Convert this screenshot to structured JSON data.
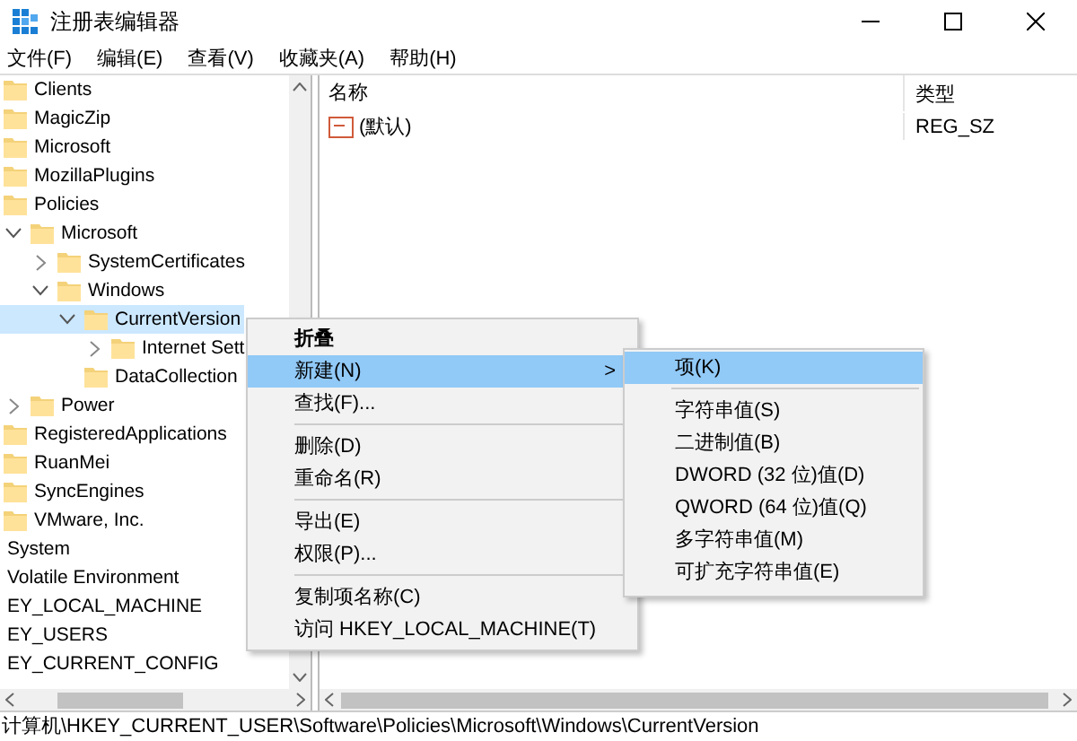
{
  "window": {
    "title": "注册表编辑器"
  },
  "menu_bar": [
    "文件(F)",
    "编辑(E)",
    "查看(V)",
    "收藏夹(A)",
    "帮助(H)"
  ],
  "tree": [
    {
      "label": "Clients",
      "kind": "leaf",
      "selected": false
    },
    {
      "label": "MagicZip",
      "kind": "leaf",
      "selected": false
    },
    {
      "label": "Microsoft",
      "kind": "leaf",
      "selected": false
    },
    {
      "label": "MozillaPlugins",
      "kind": "leaf",
      "selected": false
    },
    {
      "label": "Policies",
      "kind": "leaf",
      "selected": false,
      "children": [
        {
          "label": "Microsoft",
          "kind": "open",
          "selected": false,
          "children": [
            {
              "label": "SystemCertificates",
              "kind": "closed",
              "selected": false
            },
            {
              "label": "Windows",
              "kind": "open",
              "selected": false,
              "children": [
                {
                  "label": "CurrentVersion",
                  "kind": "open",
                  "selected": true,
                  "children": [
                    {
                      "label": "Internet Sett",
                      "kind": "closed",
                      "selected": false
                    }
                  ]
                },
                {
                  "label": "DataCollection",
                  "kind": "leaf",
                  "selected": false
                }
              ]
            }
          ]
        },
        {
          "label": "Power",
          "kind": "closed",
          "selected": false
        }
      ]
    },
    {
      "label": "RegisteredApplications",
      "kind": "leaf",
      "selected": false
    },
    {
      "label": "RuanMei",
      "kind": "leaf",
      "selected": false
    },
    {
      "label": "SyncEngines",
      "kind": "leaf",
      "selected": false
    },
    {
      "label": "VMware, Inc.",
      "kind": "leaf",
      "selected": false
    },
    {
      "label": "System",
      "kind": "key",
      "selected": false
    },
    {
      "label": "Volatile Environment",
      "kind": "key",
      "selected": false
    },
    {
      "label": "EY_LOCAL_MACHINE",
      "kind": "key",
      "selected": false
    },
    {
      "label": "EY_USERS",
      "kind": "key",
      "selected": false
    },
    {
      "label": "EY_CURRENT_CONFIG",
      "kind": "key",
      "selected": false
    }
  ],
  "values_table": {
    "columns": [
      "名称",
      "类型"
    ],
    "rows": [
      {
        "name": "(默认)",
        "type": "REG_SZ"
      }
    ]
  },
  "context_menu": [
    {
      "kind": "item",
      "label": "折叠",
      "default": true,
      "selected": false
    },
    {
      "kind": "item",
      "label": "新建(N)",
      "default": false,
      "selected": true,
      "submenu_arrow": ">"
    },
    {
      "kind": "item",
      "label": "查找(F)...",
      "default": false,
      "selected": false
    },
    {
      "kind": "separator"
    },
    {
      "kind": "item",
      "label": "删除(D)",
      "default": false,
      "selected": false
    },
    {
      "kind": "item",
      "label": "重命名(R)",
      "default": false,
      "selected": false
    },
    {
      "kind": "separator"
    },
    {
      "kind": "item",
      "label": "导出(E)",
      "default": false,
      "selected": false
    },
    {
      "kind": "item",
      "label": "权限(P)...",
      "default": false,
      "selected": false
    },
    {
      "kind": "separator"
    },
    {
      "kind": "item",
      "label": "复制项名称(C)",
      "default": false,
      "selected": false
    },
    {
      "kind": "item",
      "label": "访问 HKEY_LOCAL_MACHINE(T)",
      "default": false,
      "selected": false
    }
  ],
  "submenu": [
    {
      "kind": "item",
      "label": "项(K)",
      "selected": true
    },
    {
      "kind": "separator"
    },
    {
      "kind": "item",
      "label": "字符串值(S)",
      "selected": false
    },
    {
      "kind": "item",
      "label": "二进制值(B)",
      "selected": false
    },
    {
      "kind": "item",
      "label": "DWORD (32 位)值(D)",
      "selected": false
    },
    {
      "kind": "item",
      "label": "QWORD (64 位)值(Q)",
      "selected": false
    },
    {
      "kind": "item",
      "label": "多字符串值(M)",
      "selected": false
    },
    {
      "kind": "item",
      "label": "可扩充字符串值(E)",
      "selected": false
    }
  ],
  "status_bar": "计算机\\HKEY_CURRENT_USER\\Software\\Policies\\Microsoft\\Windows\\CurrentVersion"
}
